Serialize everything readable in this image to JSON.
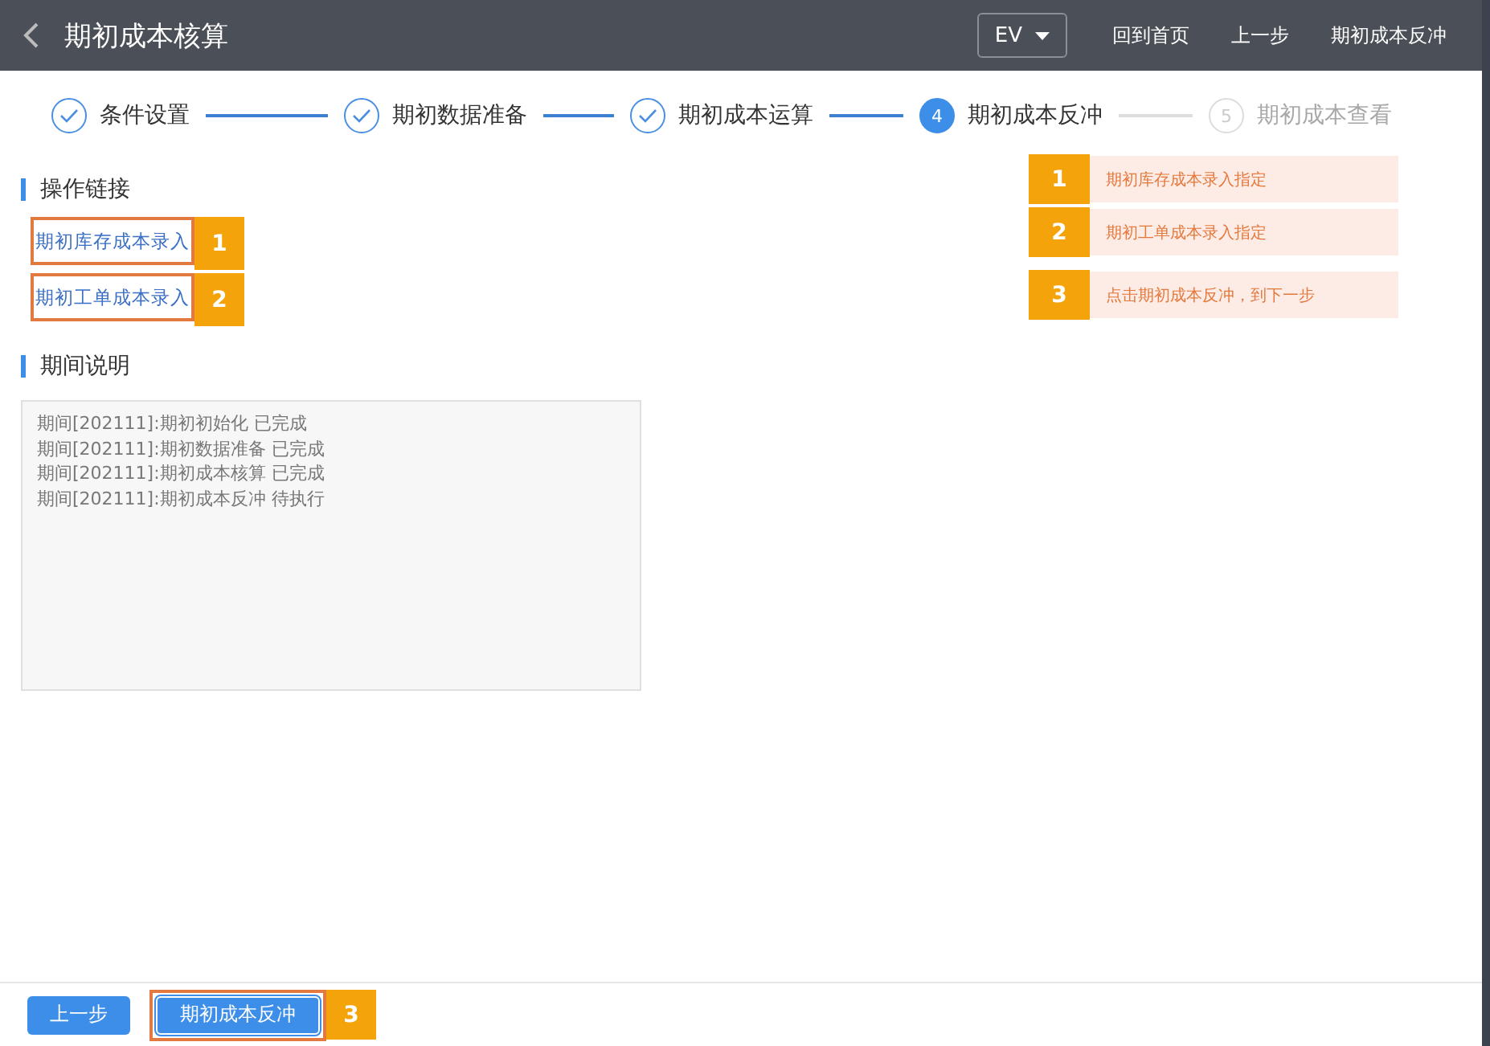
{
  "header": {
    "title": "期初成本核算",
    "dropdown": "EV",
    "actions": [
      "回到首页",
      "上一步",
      "期初成本反冲"
    ]
  },
  "steps": [
    {
      "label": "条件设置",
      "kind": "done"
    },
    {
      "label": "期初数据准备",
      "kind": "done"
    },
    {
      "label": "期初成本运算",
      "kind": "done"
    },
    {
      "number": "4",
      "label": "期初成本反冲",
      "kind": "active"
    },
    {
      "number": "5",
      "label": "期初成本查看",
      "kind": "pending"
    }
  ],
  "links_section": {
    "title": "操作链接",
    "links": [
      {
        "label": "期初库存成本录入",
        "badge": "1"
      },
      {
        "label": "期初工单成本录入",
        "badge": "2"
      }
    ]
  },
  "period_section": {
    "title": "期间说明",
    "lines": [
      "期间[202111]:期初初始化 已完成",
      "期间[202111]:期初数据准备 已完成",
      "期间[202111]:期初成本核算 已完成",
      "期间[202111]:期初成本反冲 待执行"
    ]
  },
  "hints": [
    {
      "badge": "1",
      "text": "期初库存成本录入指定"
    },
    {
      "badge": "2",
      "text": "期初工单成本录入指定"
    },
    {
      "badge": "3",
      "text": "点击期初成本反冲，到下一步"
    }
  ],
  "footer": {
    "buttons": [
      {
        "label": "上一步",
        "highlighted": false
      },
      {
        "label": "期初成本反冲",
        "highlighted": true,
        "badge": "3"
      }
    ]
  }
}
